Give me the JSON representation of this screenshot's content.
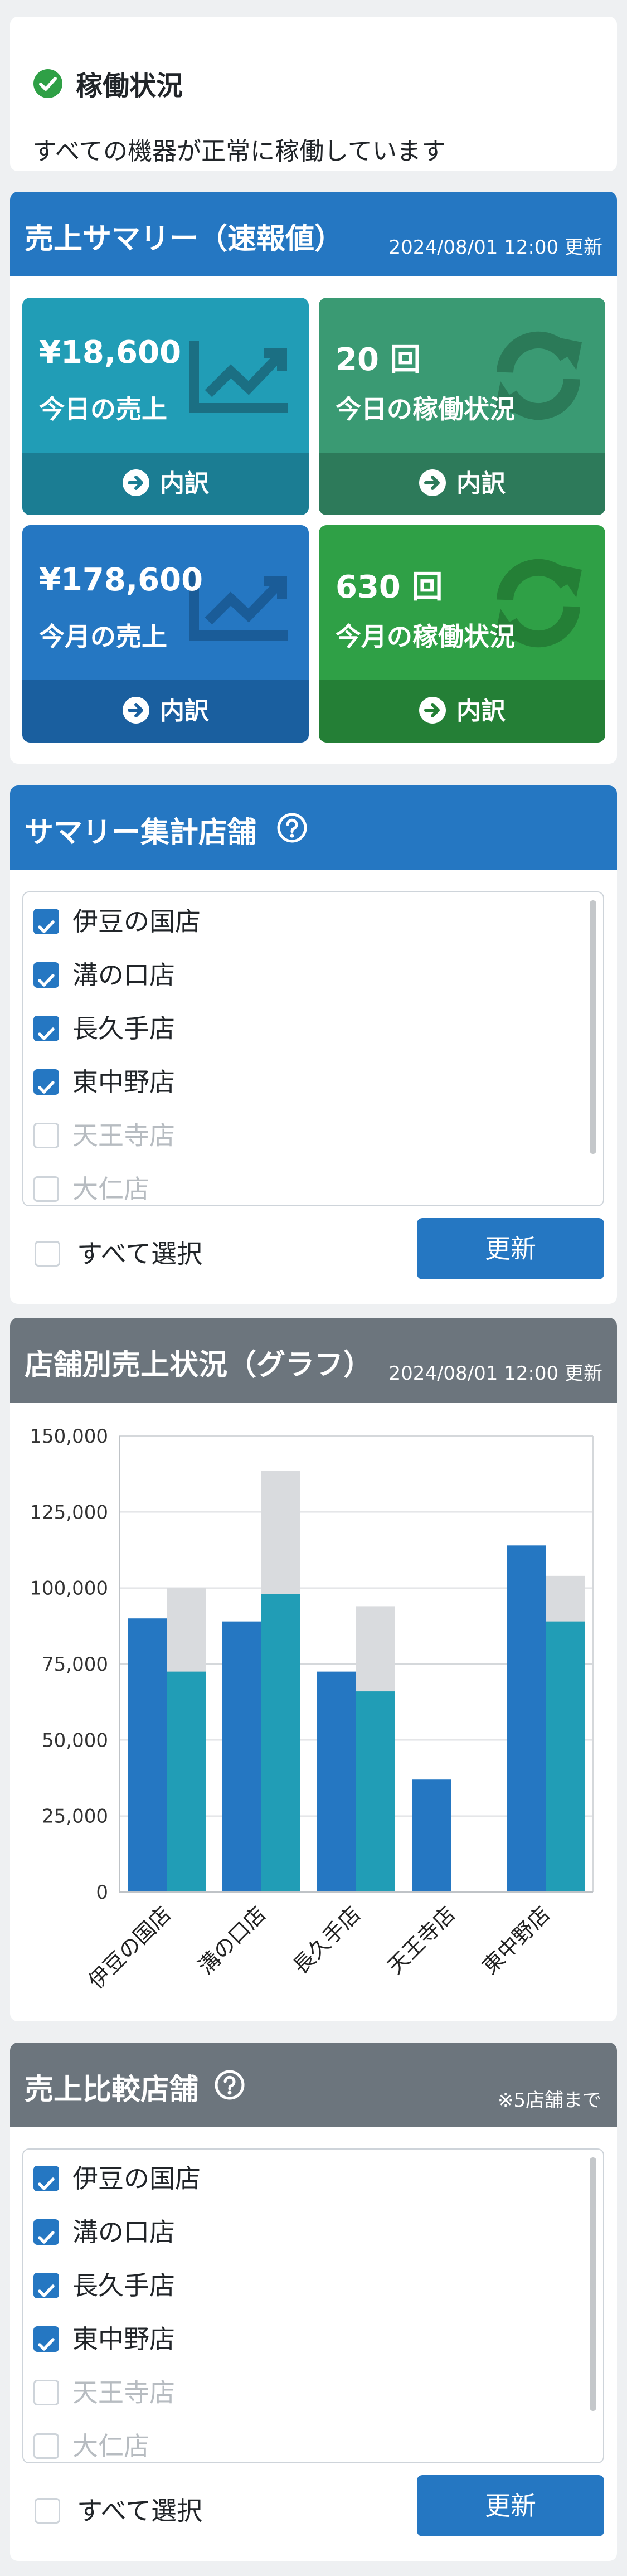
{
  "status": {
    "title": "稼働状況",
    "message": "すべての機器が正常に稼働しています",
    "check_color": "#2fa046"
  },
  "summary": {
    "title": "売上サマリー（速報値）",
    "updated": "2024/08/01 12:00 更新",
    "tiles": [
      {
        "value": "¥18,600",
        "label": "今日の売上",
        "footer": "内訳",
        "icon": "trend-chart-icon"
      },
      {
        "value": "20 回",
        "label": "今日の稼働状況",
        "footer": "内訳",
        "icon": "sync-icon"
      },
      {
        "value": "¥178,600",
        "label": "今月の売上",
        "footer": "内訳",
        "icon": "trend-chart-icon"
      },
      {
        "value": "630 回",
        "label": "今月の稼働状況",
        "footer": "内訳",
        "icon": "sync-icon"
      }
    ]
  },
  "summary_stores": {
    "title": "サマリー集計店舗",
    "items": [
      {
        "label": "伊豆の国店",
        "checked": true
      },
      {
        "label": "溝の口店",
        "checked": true
      },
      {
        "label": "長久手店",
        "checked": true
      },
      {
        "label": "東中野店",
        "checked": true
      },
      {
        "label": "天王寺店",
        "checked": false
      },
      {
        "label": "大仁店",
        "checked": false
      }
    ],
    "select_all": "すべて選択",
    "update_button": "更新"
  },
  "graph": {
    "title": "店舗別売上状況（グラフ）",
    "updated": "2024/08/01 12:00 更新"
  },
  "chart_data": {
    "type": "bar",
    "categories": [
      "伊豆の国店",
      "溝の口店",
      "長久手店",
      "天王寺店",
      "東中野店"
    ],
    "series": [
      {
        "values": [
          90000,
          89000,
          72500,
          37000,
          114000
        ],
        "color": "#2577c2"
      },
      {
        "values": [
          72500,
          98000,
          66000,
          null,
          89000
        ],
        "color": "#219db6",
        "stack_top": [
          100000,
          138500,
          94000,
          null,
          104000
        ],
        "stack_color": "#d9dbde"
      }
    ],
    "ylim": [
      0,
      150000
    ],
    "yticks": [
      "150,000",
      "125,000",
      "100,000",
      "75,000",
      "50,000",
      "25,000",
      "0"
    ],
    "grid": true
  },
  "compare_stores": {
    "title": "売上比較店舗",
    "note": "※5店舗まで",
    "items": [
      {
        "label": "伊豆の国店",
        "checked": true
      },
      {
        "label": "溝の口店",
        "checked": true
      },
      {
        "label": "長久手店",
        "checked": true
      },
      {
        "label": "東中野店",
        "checked": true
      },
      {
        "label": "天王寺店",
        "checked": false
      },
      {
        "label": "大仁店",
        "checked": false
      }
    ],
    "select_all": "すべて選択",
    "update_button": "更新"
  }
}
